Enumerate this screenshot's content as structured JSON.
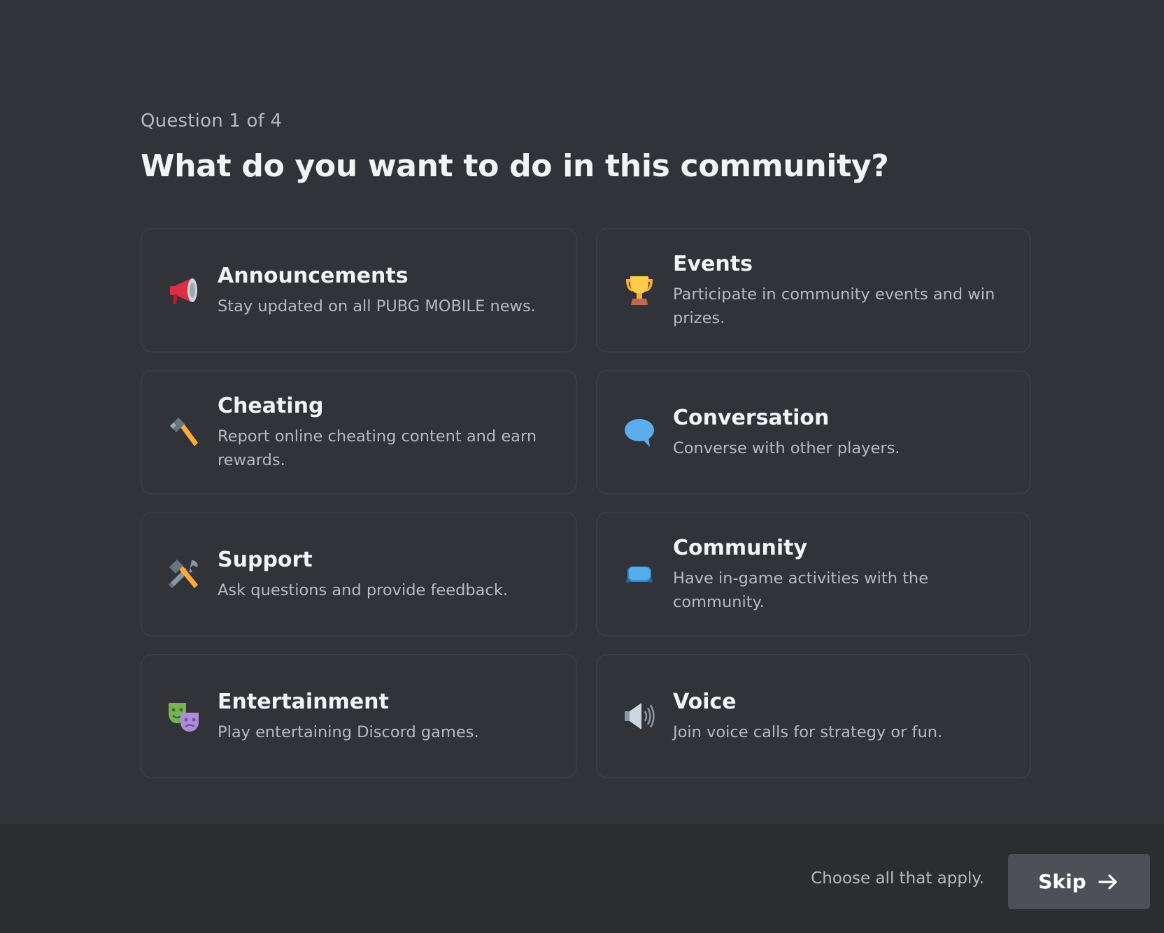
{
  "header": {
    "counter": "Question 1 of 4",
    "title": "What do you want to do in this community?"
  },
  "options": [
    {
      "title": "Announcements",
      "description": "Stay updated on all PUBG MOBILE news.",
      "icon": "megaphone-icon"
    },
    {
      "title": "Events",
      "description": "Participate in community events and win prizes.",
      "icon": "trophy-icon"
    },
    {
      "title": "Cheating",
      "description": "Report online cheating content and earn rewards.",
      "icon": "hammer-icon"
    },
    {
      "title": "Conversation",
      "description": "Converse with other players.",
      "icon": "speech-bubble-icon"
    },
    {
      "title": "Support",
      "description": "Ask questions and provide feedback.",
      "icon": "hammer-wrench-icon"
    },
    {
      "title": "Community",
      "description": "Have in-game activities with the community.",
      "icon": "game-controller-icon"
    },
    {
      "title": "Entertainment",
      "description": "Play entertaining Discord games.",
      "icon": "theater-masks-icon"
    },
    {
      "title": "Voice",
      "description": "Join voice calls for strategy or fun.",
      "icon": "speaker-icon"
    }
  ],
  "footer": {
    "hint": "Choose all that apply.",
    "skip_label": "Skip",
    "skip_icon": "arrow-right-icon"
  },
  "colors": {
    "background": "#313338",
    "footer_background": "#2b2d31",
    "card_border": "#3a3c42",
    "button": "#4e5058",
    "text_primary": "#f2f3f5",
    "text_muted": "#b5bac1"
  }
}
